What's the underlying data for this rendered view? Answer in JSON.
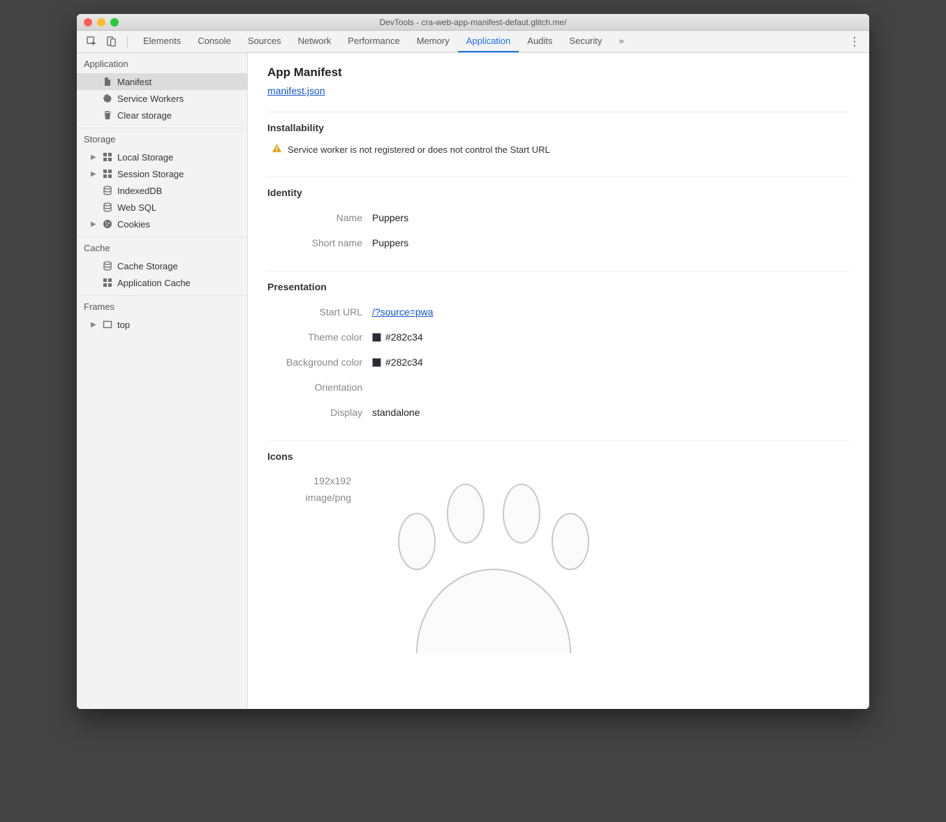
{
  "window": {
    "title": "DevTools - cra-web-app-manifest-defaut.glitch.me/"
  },
  "toolbar": {
    "tabs": [
      "Elements",
      "Console",
      "Sources",
      "Network",
      "Performance",
      "Memory",
      "Application",
      "Audits",
      "Security"
    ],
    "active_tab": "Application",
    "overflow_glyph": "»",
    "menu_glyph": "⋮"
  },
  "sidebar": {
    "groups": [
      {
        "title": "Application",
        "items": [
          {
            "icon": "document-icon",
            "label": "Manifest",
            "selected": true
          },
          {
            "icon": "gear-icon",
            "label": "Service Workers"
          },
          {
            "icon": "trash-icon",
            "label": "Clear storage"
          }
        ]
      },
      {
        "title": "Storage",
        "items": [
          {
            "arrow": true,
            "icon": "grid-icon",
            "label": "Local Storage"
          },
          {
            "arrow": true,
            "icon": "grid-icon",
            "label": "Session Storage"
          },
          {
            "icon": "database-icon",
            "label": "IndexedDB"
          },
          {
            "icon": "database-icon",
            "label": "Web SQL"
          },
          {
            "arrow": true,
            "icon": "cookie-icon",
            "label": "Cookies"
          }
        ]
      },
      {
        "title": "Cache",
        "items": [
          {
            "icon": "database-icon",
            "label": "Cache Storage"
          },
          {
            "icon": "grid-icon",
            "label": "Application Cache"
          }
        ]
      },
      {
        "title": "Frames",
        "items": [
          {
            "arrow": true,
            "icon": "frame-icon",
            "label": "top"
          }
        ]
      }
    ]
  },
  "manifest": {
    "title": "App Manifest",
    "file_link": "manifest.json",
    "installability": {
      "heading": "Installability",
      "warning": "Service worker is not registered or does not control the Start URL"
    },
    "identity": {
      "heading": "Identity",
      "name_label": "Name",
      "name_value": "Puppers",
      "short_name_label": "Short name",
      "short_name_value": "Puppers"
    },
    "presentation": {
      "heading": "Presentation",
      "start_url_label": "Start URL",
      "start_url_value": "/?source=pwa",
      "theme_color_label": "Theme color",
      "theme_color_value": "#282c34",
      "background_color_label": "Background color",
      "background_color_value": "#282c34",
      "orientation_label": "Orientation",
      "orientation_value": "",
      "display_label": "Display",
      "display_value": "standalone"
    },
    "icons": {
      "heading": "Icons",
      "size": "192x192",
      "mime": "image/png"
    }
  }
}
